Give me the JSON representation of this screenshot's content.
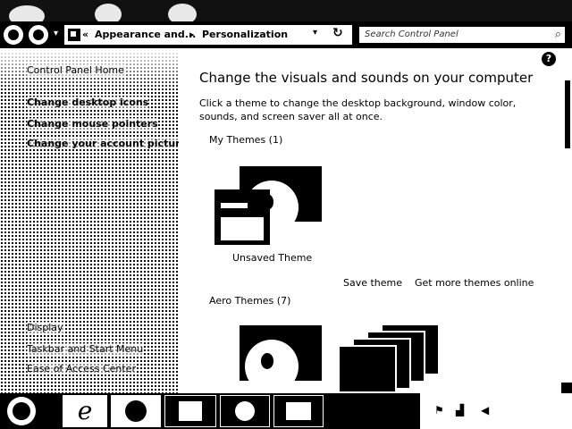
{
  "nav": {
    "history_arrow": "▾",
    "crumb_prefix": "«",
    "crumb_1": "Appearance and...",
    "crumb_sep": "▸",
    "crumb_2": "Personalization",
    "dropdown": "▾",
    "refresh": "↻",
    "search_placeholder": "Search Control Panel",
    "search_icon": "⌕"
  },
  "sidebar": {
    "items": [
      {
        "label": "Control Panel Home"
      },
      {
        "label": "Change desktop icons"
      },
      {
        "label": "Change mouse pointers"
      },
      {
        "label": "Change your account picture"
      }
    ],
    "see_also": [
      {
        "label": "Display"
      },
      {
        "label": "Taskbar and Start Menu"
      },
      {
        "label": "Ease of Access Center"
      }
    ]
  },
  "content": {
    "help": "?",
    "title": "Change the visuals and sounds on your computer",
    "description": "Click a theme to change the desktop background, window color, sounds, and screen saver all at once.",
    "my_themes_header": "My Themes (1)",
    "unsaved_theme_label": "Unsaved Theme",
    "save_theme_link": "Save theme",
    "get_more_link": "Get more themes online",
    "aero_themes_header": "Aero Themes (7)"
  },
  "taskbar": {
    "ie_icon": "e"
  },
  "tray": {
    "icons": [
      "flag-icon",
      "network-icon",
      "volume-icon"
    ]
  }
}
